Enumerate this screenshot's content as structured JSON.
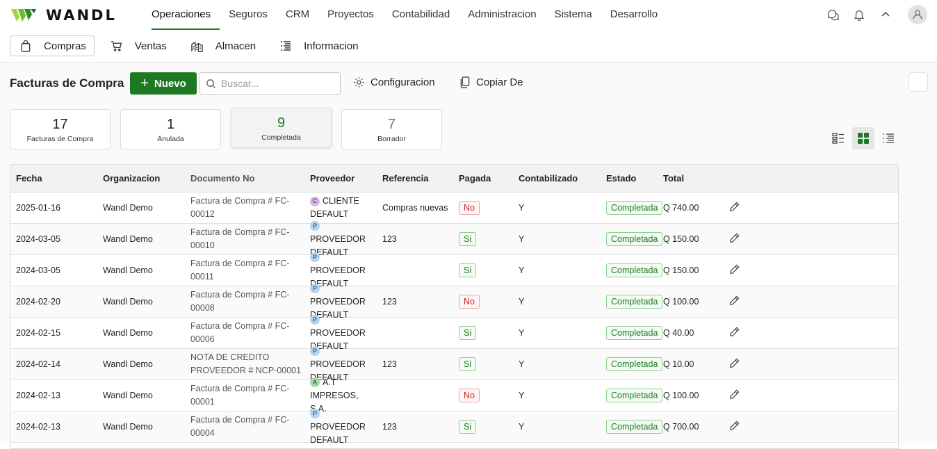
{
  "brand": {
    "name": "WANDL"
  },
  "topnav": {
    "items": [
      {
        "label": "Operaciones",
        "active": true
      },
      {
        "label": "Seguros"
      },
      {
        "label": "CRM"
      },
      {
        "label": "Proyectos"
      },
      {
        "label": "Contabilidad"
      },
      {
        "label": "Administracion"
      },
      {
        "label": "Sistema"
      },
      {
        "label": "Desarrollo"
      }
    ],
    "icons": [
      "chat-icon",
      "bell-icon",
      "chevron-up-icon",
      "user-avatar-icon"
    ]
  },
  "subnav": {
    "tabs": [
      {
        "label": "Compras",
        "icon": "bag-icon",
        "active": true
      },
      {
        "label": "Ventas",
        "icon": "cart-icon"
      },
      {
        "label": "Almacen",
        "icon": "warehouse-icon"
      },
      {
        "label": "Informacion",
        "icon": "list-icon"
      }
    ]
  },
  "toolbar": {
    "title": "Facturas de Compra",
    "new_label": "Nuevo",
    "search_placeholder": "Buscar...",
    "config_label": "Configuracion",
    "copy_label": "Copiar De"
  },
  "stats": [
    {
      "value": "17",
      "label": "Facturas de Compra"
    },
    {
      "value": "1",
      "label": "Anulada"
    },
    {
      "value": "9",
      "label": "Completada",
      "selected": true
    },
    {
      "value": "7",
      "label": "Borrador"
    }
  ],
  "table": {
    "columns": [
      "Fecha",
      "Organizacion",
      "Documento No",
      "Proveedor",
      "Referencia",
      "Pagada",
      "Contabilizado",
      "Estado",
      "Total"
    ],
    "rows": [
      {
        "fecha": "2025-01-16",
        "org": "Wandl Demo",
        "doc": "Factura de Compra # FC-00012",
        "prov_initial": "C",
        "prov_color": "#d8b4e8",
        "prov": "CLIENTE DEFAULT",
        "ref": "Compras nuevas",
        "pagada": "No",
        "cont": "Y",
        "estado": "Completada",
        "total": "Q 740.00"
      },
      {
        "fecha": "2024-03-05",
        "org": "Wandl Demo",
        "doc": "Factura de Compra # FC-00010",
        "prov_initial": "P",
        "prov_color": "#b3d4f0",
        "prov": "PROVEEDOR DEFAULT",
        "ref": "123",
        "pagada": "Si",
        "cont": "Y",
        "estado": "Completada",
        "total": "Q 150.00"
      },
      {
        "fecha": "2024-03-05",
        "org": "Wandl Demo",
        "doc": "Factura de Compra # FC-00011",
        "prov_initial": "P",
        "prov_color": "#b3d4f0",
        "prov": "PROVEEDOR DEFAULT",
        "ref": "",
        "pagada": "Si",
        "cont": "Y",
        "estado": "Completada",
        "total": "Q 150.00"
      },
      {
        "fecha": "2024-02-20",
        "org": "Wandl Demo",
        "doc": "Factura de Compra # FC-00008",
        "prov_initial": "P",
        "prov_color": "#b3d4f0",
        "prov": "PROVEEDOR DEFAULT",
        "ref": "123",
        "pagada": "No",
        "cont": "Y",
        "estado": "Completada",
        "total": "Q 100.00"
      },
      {
        "fecha": "2024-02-15",
        "org": "Wandl Demo",
        "doc": "Factura de Compra # FC-00006",
        "prov_initial": "P",
        "prov_color": "#b3d4f0",
        "prov": "PROVEEDOR DEFAULT",
        "ref": "",
        "pagada": "Si",
        "cont": "Y",
        "estado": "Completada",
        "total": "Q 40.00"
      },
      {
        "fecha": "2024-02-14",
        "org": "Wandl Demo",
        "doc": "NOTA DE CREDITO PROVEEDOR # NCP-00001",
        "prov_initial": "P",
        "prov_color": "#b3d4f0",
        "prov": "PROVEEDOR DEFAULT",
        "ref": "123",
        "pagada": "Si",
        "cont": "Y",
        "estado": "Completada",
        "total": "Q 10.00"
      },
      {
        "fecha": "2024-02-13",
        "org": "Wandl Demo",
        "doc": "Factura de Compra # FC-00001",
        "prov_initial": "A",
        "prov_color": "#a8d8a8",
        "prov": "A.T IMPRESOS, S.A.",
        "ref": "",
        "pagada": "No",
        "cont": "Y",
        "estado": "Completada",
        "total": "Q 100.00"
      },
      {
        "fecha": "2024-02-13",
        "org": "Wandl Demo",
        "doc": "Factura de Compra # FC-00004",
        "prov_initial": "P",
        "prov_color": "#b3d4f0",
        "prov": "PROVEEDOR DEFAULT",
        "ref": "123",
        "pagada": "Si",
        "cont": "Y",
        "estado": "Completada",
        "total": "Q 700.00"
      }
    ]
  },
  "colors": {
    "accent": "#1e7a22",
    "danger": "#c62828"
  }
}
